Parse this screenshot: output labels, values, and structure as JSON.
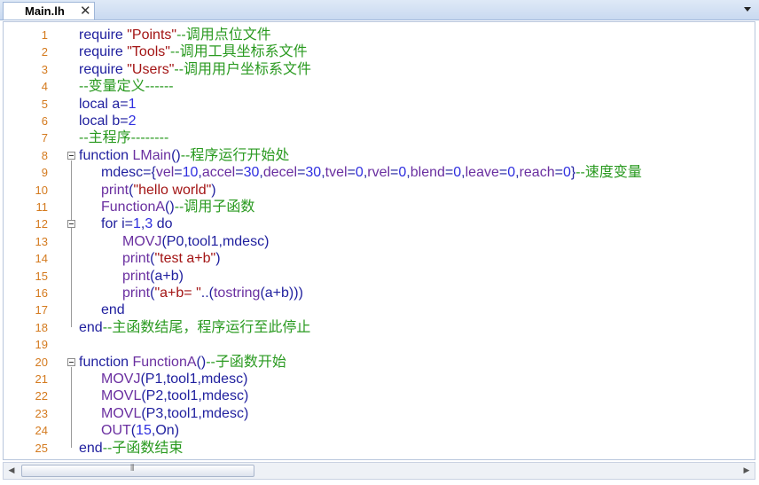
{
  "tab": {
    "title": "Main.lh",
    "close_glyph": "✕"
  },
  "scrollbar": {
    "left_glyph": "◀",
    "right_glyph": "▶",
    "thumb_grip": "⦀"
  },
  "colors": {
    "line_number": "#d47a1e",
    "comment": "#2a9a20",
    "string": "#a31515",
    "number": "#2f2fe0",
    "keyword": "#1f1f9e",
    "identifier": "#6a2fa0",
    "default": "#1f1f9e"
  },
  "lines": [
    {
      "n": "1",
      "segs": [
        [
          "keyword",
          "require "
        ],
        [
          "string",
          "\"Points\""
        ],
        [
          "comment",
          "--调用点位文件"
        ]
      ]
    },
    {
      "n": "2",
      "segs": [
        [
          "keyword",
          "require "
        ],
        [
          "string",
          "\"Tools\""
        ],
        [
          "comment",
          "--调用工具坐标系文件"
        ]
      ]
    },
    {
      "n": "3",
      "segs": [
        [
          "keyword",
          "require "
        ],
        [
          "string",
          "\"Users\""
        ],
        [
          "comment",
          "--调用用户坐标系文件"
        ]
      ]
    },
    {
      "n": "4",
      "segs": [
        [
          "comment",
          "--变量定义------"
        ]
      ]
    },
    {
      "n": "5",
      "segs": [
        [
          "keyword",
          "local a"
        ],
        [
          "keyword",
          "="
        ],
        [
          "number",
          "1"
        ]
      ]
    },
    {
      "n": "6",
      "segs": [
        [
          "keyword",
          "local b"
        ],
        [
          "keyword",
          "="
        ],
        [
          "number",
          "2"
        ]
      ]
    },
    {
      "n": "7",
      "segs": [
        [
          "comment",
          "--主程序--------"
        ]
      ]
    },
    {
      "n": "8",
      "segs": [
        [
          "keyword",
          "function "
        ],
        [
          "identifier",
          "LMain"
        ],
        [
          "keyword",
          "()"
        ],
        [
          "comment",
          "--程序运行开始处"
        ]
      ]
    },
    {
      "n": "9",
      "segs": [
        [
          "keyword",
          "mdesc={"
        ],
        [
          "identifier",
          "vel"
        ],
        [
          "keyword",
          "="
        ],
        [
          "number",
          "10"
        ],
        [
          "keyword",
          ","
        ],
        [
          "identifier",
          "accel"
        ],
        [
          "keyword",
          "="
        ],
        [
          "number",
          "30"
        ],
        [
          "keyword",
          ","
        ],
        [
          "identifier",
          "decel"
        ],
        [
          "keyword",
          "="
        ],
        [
          "number",
          "30"
        ],
        [
          "keyword",
          ","
        ],
        [
          "identifier",
          "tvel"
        ],
        [
          "keyword",
          "="
        ],
        [
          "number",
          "0"
        ],
        [
          "keyword",
          ","
        ],
        [
          "identifier",
          "rvel"
        ],
        [
          "keyword",
          "="
        ],
        [
          "number",
          "0"
        ],
        [
          "keyword",
          ","
        ],
        [
          "identifier",
          "blend"
        ],
        [
          "keyword",
          "="
        ],
        [
          "number",
          "0"
        ],
        [
          "keyword",
          ","
        ],
        [
          "identifier",
          "leave"
        ],
        [
          "keyword",
          "="
        ],
        [
          "number",
          "0"
        ],
        [
          "keyword",
          ","
        ],
        [
          "identifier",
          "reach"
        ],
        [
          "keyword",
          "="
        ],
        [
          "number",
          "0"
        ],
        [
          "keyword",
          "}"
        ],
        [
          "comment",
          "--速度变量"
        ]
      ]
    },
    {
      "n": "10",
      "segs": [
        [
          "identifier",
          "print"
        ],
        [
          "keyword",
          "("
        ],
        [
          "string",
          "\"hello world\""
        ],
        [
          "keyword",
          ")"
        ]
      ]
    },
    {
      "n": "11",
      "segs": [
        [
          "identifier",
          "FunctionA"
        ],
        [
          "keyword",
          "()"
        ],
        [
          "comment",
          "--调用子函数"
        ]
      ]
    },
    {
      "n": "12",
      "segs": [
        [
          "keyword",
          "for i"
        ],
        [
          "keyword",
          "="
        ],
        [
          "number",
          "1"
        ],
        [
          "keyword",
          ","
        ],
        [
          "number",
          "3"
        ],
        [
          "keyword",
          " do"
        ]
      ]
    },
    {
      "n": "13",
      "segs": [
        [
          "identifier",
          "MOVJ"
        ],
        [
          "keyword",
          "(P0,tool1,mdesc)"
        ]
      ]
    },
    {
      "n": "14",
      "segs": [
        [
          "identifier",
          "print"
        ],
        [
          "keyword",
          "("
        ],
        [
          "string",
          "\"test a+b\""
        ],
        [
          "keyword",
          ")"
        ]
      ]
    },
    {
      "n": "15",
      "segs": [
        [
          "identifier",
          "print"
        ],
        [
          "keyword",
          "(a+b)"
        ]
      ]
    },
    {
      "n": "16",
      "segs": [
        [
          "identifier",
          "print"
        ],
        [
          "keyword",
          "("
        ],
        [
          "string",
          "\"a+b= \""
        ],
        [
          "keyword",
          "..("
        ],
        [
          "identifier",
          "tostring"
        ],
        [
          "keyword",
          "(a+b)))"
        ]
      ]
    },
    {
      "n": "17",
      "segs": [
        [
          "keyword",
          "end"
        ]
      ]
    },
    {
      "n": "18",
      "segs": [
        [
          "keyword",
          "end"
        ],
        [
          "comment",
          "--主函数结尾，程序运行至此停止"
        ]
      ]
    },
    {
      "n": "19",
      "segs": []
    },
    {
      "n": "20",
      "segs": [
        [
          "keyword",
          "function "
        ],
        [
          "identifier",
          "FunctionA"
        ],
        [
          "keyword",
          "()"
        ],
        [
          "comment",
          "--子函数开始"
        ]
      ]
    },
    {
      "n": "21",
      "segs": [
        [
          "identifier",
          "MOVJ"
        ],
        [
          "keyword",
          "(P1,tool1,mdesc)"
        ]
      ]
    },
    {
      "n": "22",
      "segs": [
        [
          "identifier",
          "MOVL"
        ],
        [
          "keyword",
          "(P2,tool1,mdesc)"
        ]
      ]
    },
    {
      "n": "23",
      "segs": [
        [
          "identifier",
          "MOVL"
        ],
        [
          "keyword",
          "(P3,tool1,mdesc)"
        ]
      ]
    },
    {
      "n": "24",
      "segs": [
        [
          "identifier",
          "OUT"
        ],
        [
          "keyword",
          "("
        ],
        [
          "number",
          "15"
        ],
        [
          "keyword",
          ",On)"
        ]
      ]
    },
    {
      "n": "25",
      "segs": [
        [
          "keyword",
          "end"
        ],
        [
          "comment",
          "--子函数结束"
        ]
      ]
    }
  ]
}
